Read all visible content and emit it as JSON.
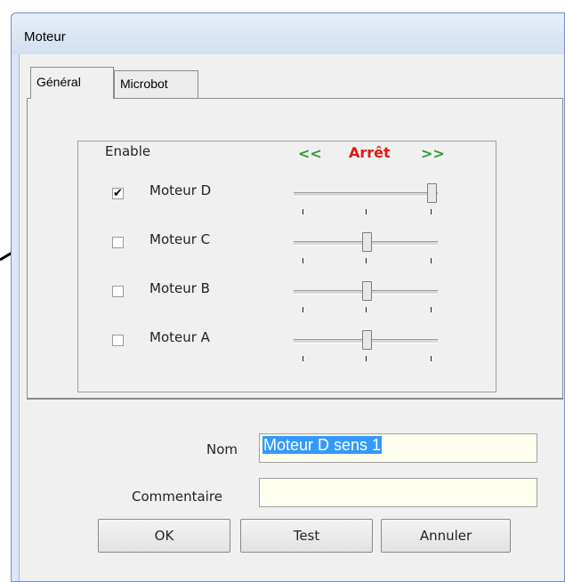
{
  "window": {
    "title": "Moteur"
  },
  "tabs": [
    {
      "label": "Général",
      "active": true
    },
    {
      "label": "Microbot",
      "active": false
    }
  ],
  "group": {
    "label": "Enable",
    "nav_prev": "<<",
    "nav_next": ">>",
    "status": "Arrêt",
    "motors": [
      {
        "label": "Moteur D",
        "checked": true,
        "check_mark": "✔",
        "slider_position": "max"
      },
      {
        "label": "Moteur C",
        "checked": false,
        "check_mark": "",
        "slider_position": "center"
      },
      {
        "label": "Moteur B",
        "checked": false,
        "check_mark": "",
        "slider_position": "center"
      },
      {
        "label": "Moteur A",
        "checked": false,
        "check_mark": "",
        "slider_position": "center"
      }
    ]
  },
  "form": {
    "name_label": "Nom",
    "name_value": "Moteur D sens 1",
    "comment_label": "Commentaire",
    "comment_value": ""
  },
  "buttons": {
    "ok": "OK",
    "test": "Test",
    "cancel": "Annuler"
  },
  "colors": {
    "status": "#e01818",
    "nav": "#2f9a2f",
    "field_bg": "#ffffee",
    "selection": "#3399ff"
  }
}
